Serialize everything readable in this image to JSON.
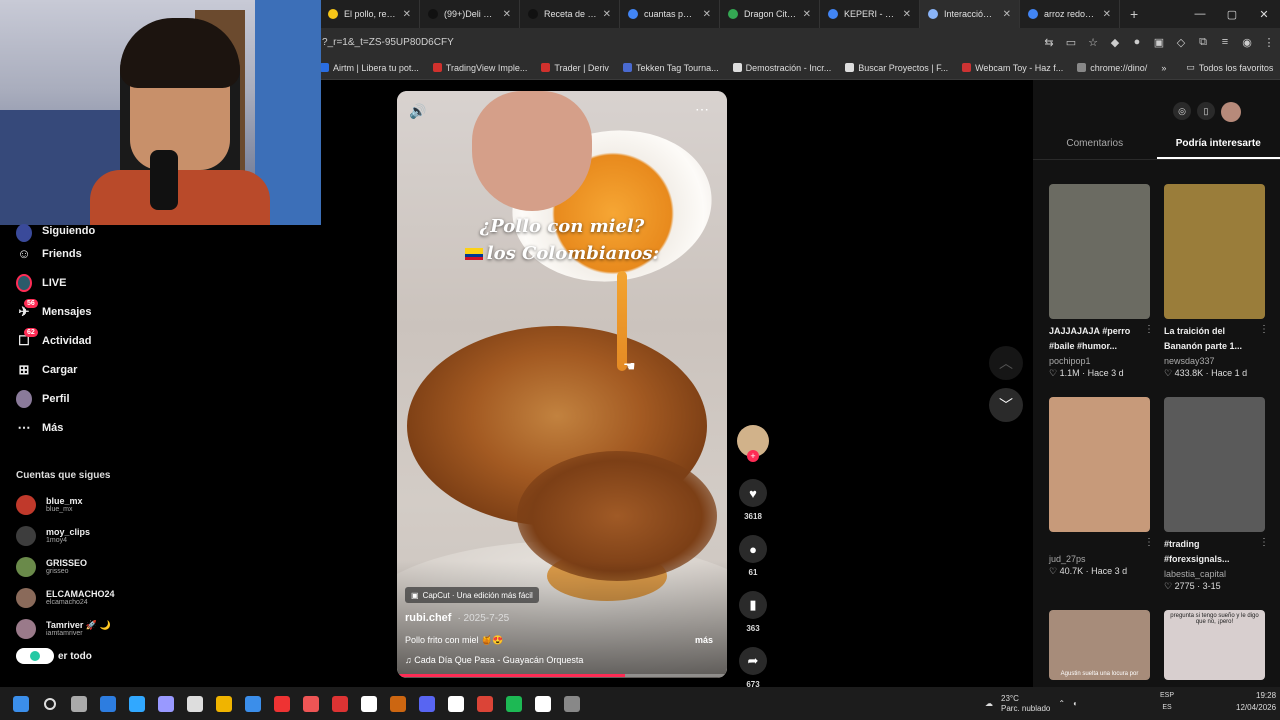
{
  "browser": {
    "tabs": [
      {
        "label": "El pollo, rey de",
        "color": "#f5c518"
      },
      {
        "label": "(99+)Deli deli",
        "color": "#111111"
      },
      {
        "label": "Receta de Kep",
        "color": "#111111"
      },
      {
        "label": "cuantas person",
        "color": "#4285f4"
      },
      {
        "label": "Dragon City -",
        "color": "#34a853"
      },
      {
        "label": "KEPERI - Busca",
        "color": "#4285f4"
      },
      {
        "label": "Interacción | El",
        "color": "#8ab4f8",
        "active": true
      },
      {
        "label": "arroz redondo",
        "color": "#4285f4"
      }
    ],
    "new_tab": "+",
    "url": "?_r=1&_t=ZS-95UP80D6CFY",
    "bookmarks": [
      "Airtm | Libera tu pot...",
      "TradingView Imple...",
      "Trader | Deriv",
      "Tekken Tag Tourna...",
      "Demostración - Incr...",
      "Buscar Proyectos | F...",
      "Webcam Toy - Haz f...",
      "chrome://dino/"
    ],
    "all_bookmarks": "Todos los favoritos"
  },
  "sidebar": {
    "nav": [
      {
        "label": "Siguiendo",
        "icon": "following-avatar-icon"
      },
      {
        "label": "Friends",
        "icon": "friends-icon"
      },
      {
        "label": "LIVE",
        "icon": "live-icon"
      },
      {
        "label": "Mensajes",
        "icon": "messages-icon",
        "badge": "56"
      },
      {
        "label": "Actividad",
        "icon": "activity-icon",
        "badge": "62"
      },
      {
        "label": "Cargar",
        "icon": "upload-icon"
      },
      {
        "label": "Perfil",
        "icon": "profile-avatar-icon"
      },
      {
        "label": "Más",
        "icon": "more-icon"
      }
    ],
    "following_title": "Cuentas que sigues",
    "accounts": [
      {
        "name": "blue_mx",
        "handle": "blue_mx",
        "color": "#c0392b"
      },
      {
        "name": "moy_clips",
        "handle": "1moy4",
        "color": "#3d3d3d"
      },
      {
        "name": "GRISSEO",
        "handle": "grisseo",
        "color": "#6a8a4a"
      },
      {
        "name": "ELCAMACHO24",
        "handle": "elcamacho24",
        "color": "#8a6a5a"
      },
      {
        "name": "Tamriver 🚀 🌙",
        "handle": "iamtamriver",
        "color": "#9a7a8a"
      }
    ],
    "see_all": "er todo"
  },
  "video": {
    "caption_line1": "¿Pollo con miel?",
    "caption_line2": "los Colombianos:",
    "capcut": "CapCut · Una edición más fácil",
    "author": "rubi.chef",
    "date": "· 2025-7-25",
    "description": "Pollo frito con miel 🍯😍",
    "more": "más",
    "music": "Cada Día Que Pasa - Guayacán Orquesta",
    "progress": 0.69
  },
  "actions": {
    "likes": "3618",
    "comments": "61",
    "saves": "363",
    "shares": "673"
  },
  "right_panel": {
    "tabs": [
      "Comentarios",
      "Podría interesarte"
    ],
    "cards": [
      {
        "title": "JAJJAJAJA #perro #baile #humor...",
        "user": "pochipop1",
        "stats": "♡ 1.1M · Hace 3 d",
        "color": "#6b6b62"
      },
      {
        "title": "La traición del Bananón parte 1...",
        "user": "newsday337",
        "stats": "♡ 433.8K · Hace 1 d",
        "color": "#9a7d3a"
      },
      {
        "title": "",
        "user": "jud_27ps",
        "stats": "♡ 40.7K · Hace 3 d",
        "color": "#c79a7a"
      },
      {
        "title": "#trading #forexsignals...",
        "user": "labestia_capital",
        "stats": "♡ 2775 · 3-15",
        "color": "#5a5a5a"
      },
      {
        "title": "",
        "user": "",
        "stats": "",
        "color": "#a78c7a"
      },
      {
        "title": "",
        "user": "",
        "stats": "",
        "color": "#d8cfcf"
      }
    ],
    "card5_caption": "Agustin suelta una locura por",
    "card6_caption": "pregunta si tengo sueño y le digo que no, ¡pero!"
  },
  "taskbar": {
    "weather": "23°C",
    "weather_desc": "Parc. nublado",
    "lang1": "ESP",
    "lang2": "ES",
    "time": "19:28",
    "date": "12/04/2026"
  }
}
